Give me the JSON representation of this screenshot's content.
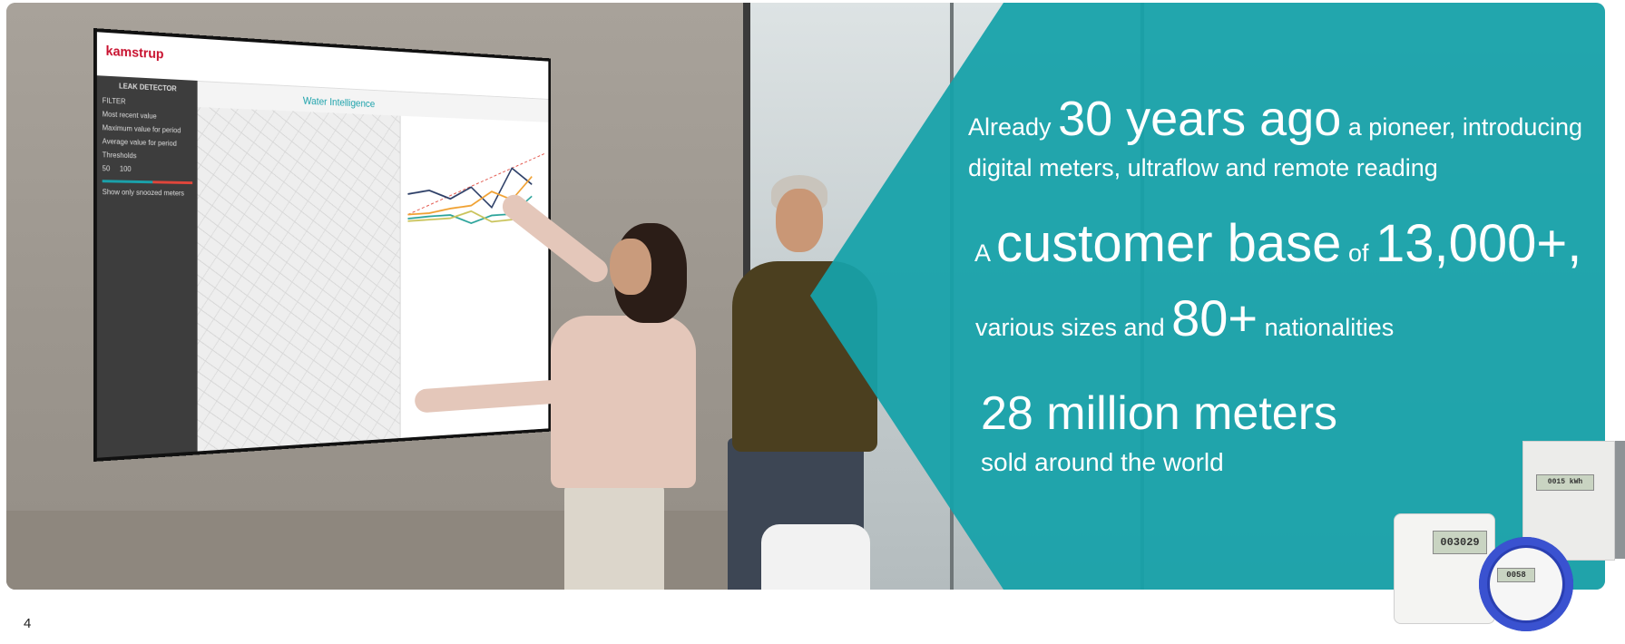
{
  "slide": {
    "page_number": "4",
    "accent_color": "#16a2a9"
  },
  "headline": {
    "line1_pre": "Already ",
    "line1_big": "30 years ago",
    "line1_post": " a pioneer, introducing",
    "line2": "digital meters, ultraflow and remote reading",
    "line3_pre": "A ",
    "line3_big": "customer base",
    "line3_mid": " of ",
    "line3_big2": "13,000+,",
    "line4_pre": "various sizes and ",
    "line4_big": "80+",
    "line4_post": " nationalities",
    "line5": "28 million meters",
    "line6": "sold around the world"
  },
  "screen": {
    "logo": "kamstrup",
    "app_title": "Water Intelligence",
    "sidebar_title": "LEAK DETECTOR",
    "filter_label": "FILTER",
    "option1": "Most recent value",
    "option2": "Maximum value for period",
    "option3": "Average value for period",
    "thresholds": "Thresholds",
    "slider_low": "50",
    "slider_high": "100",
    "checkbox": "Show only snoozed meters"
  },
  "meters": {
    "left_display": "003029",
    "round_display": "0058",
    "back_display": "0015 kWh"
  }
}
